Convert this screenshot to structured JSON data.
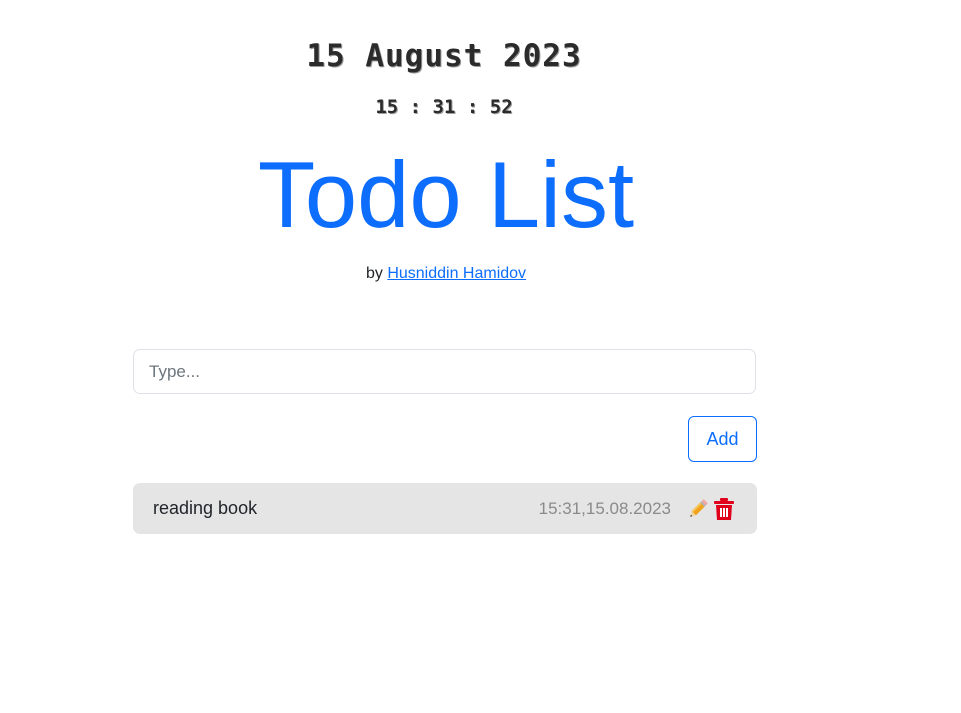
{
  "header": {
    "date": "15 August 2023",
    "clock": "15 : 31 : 52",
    "title": "Todo List",
    "byline_prefix": "by",
    "author_link": "Husniddin Hamidov"
  },
  "form": {
    "input_placeholder": "Type...",
    "input_value": "",
    "add_label": "Add"
  },
  "todos": [
    {
      "text": "reading book",
      "timestamp": "15:31,15.08.2023",
      "edit_icon": "pencil-icon",
      "delete_icon": "trash-icon"
    }
  ],
  "colors": {
    "accent": "#0d6efd",
    "delete": "#e0001b",
    "item_bg": "#e5e5e5"
  }
}
